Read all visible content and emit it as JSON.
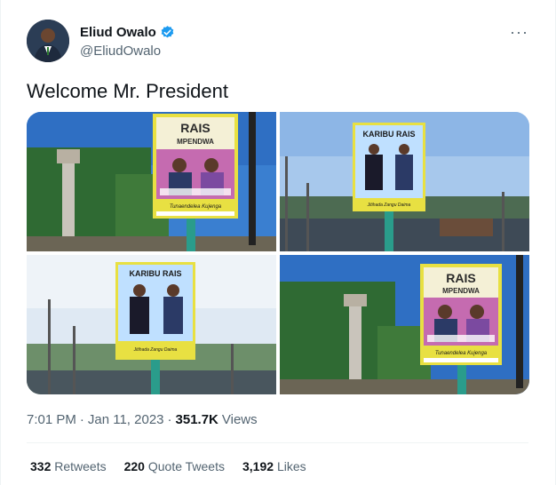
{
  "author": {
    "name": "Eliud Owalo",
    "handle": "@EliudOwalo",
    "verified": true
  },
  "tweet": {
    "text": "Welcome Mr. President",
    "time": "7:01 PM",
    "separator1": "·",
    "date": "Jan 11, 2023",
    "separator2": "·",
    "views_count": "351.7K",
    "views_label": "Views"
  },
  "media": {
    "photos": [
      {
        "billboard_title": "RAIS",
        "billboard_subtitle": "MPENDWA",
        "billboard_footer": "Tunaendelea Kujenga"
      },
      {
        "billboard_title": "KARIBU RAIS",
        "billboard_footer": "Jitihada Zangu Daima"
      },
      {
        "billboard_title": "KARIBU RAIS",
        "billboard_footer": "Jitihada Zangu Daima"
      },
      {
        "billboard_title": "RAIS",
        "billboard_subtitle": "MPENDWA",
        "billboard_footer": "Tunaendelea Kujenga"
      }
    ]
  },
  "stats": {
    "retweets_count": "332",
    "retweets_label": "Retweets",
    "quotes_count": "220",
    "quotes_label": "Quote Tweets",
    "likes_count": "3,192",
    "likes_label": "Likes"
  },
  "colors": {
    "verified_blue": "#1d9bf0",
    "secondary_text": "#536471",
    "primary_text": "#0f1419"
  },
  "icons": {
    "more": "more-options-icon",
    "verified": "verified-badge-icon"
  }
}
